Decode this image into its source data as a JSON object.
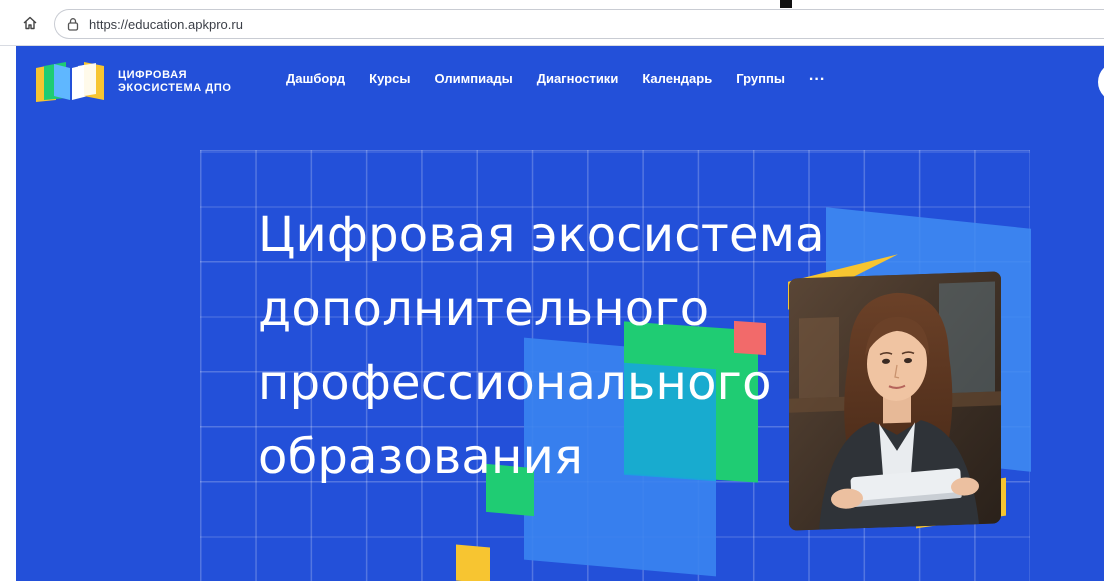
{
  "browser": {
    "url": "https://education.apkpro.ru"
  },
  "header": {
    "logo": {
      "line1": "ЦИФРОВАЯ",
      "line2": "ЭКОСИСТЕМА ДПО"
    },
    "nav": [
      {
        "label": "Дашборд"
      },
      {
        "label": "Курсы"
      },
      {
        "label": "Олимпиады"
      },
      {
        "label": "Диагностики"
      },
      {
        "label": "Календарь"
      },
      {
        "label": "Группы"
      }
    ],
    "more_label": "..."
  },
  "hero": {
    "title_lines": [
      "Цифровая экосистема",
      "дополнительного",
      "профессионального",
      "образования"
    ]
  },
  "colors": {
    "page_bg": "#2350d9",
    "accent_yellow": "#f7c531",
    "accent_green": "#1fcc73",
    "accent_light_blue": "#3f8cf2",
    "accent_red": "#f26a6a"
  },
  "icons": {
    "home": "home-icon",
    "lock": "lock-icon",
    "more": "more-horizontal-icon"
  }
}
